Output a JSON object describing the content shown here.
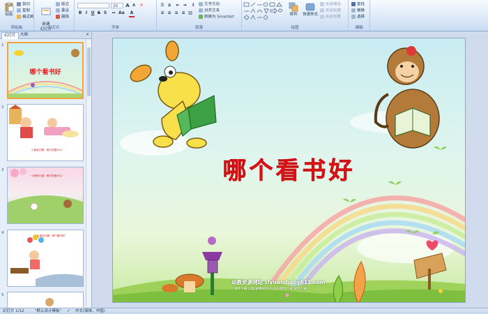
{
  "ribbon": {
    "clipboard": {
      "paste": "粘贴",
      "cut": "剪切",
      "copy": "复制",
      "format_painter": "格式刷",
      "label": "剪贴板"
    },
    "slides": {
      "new_slide": "新建\n幻灯片",
      "layout": "版式",
      "reset": "重设",
      "delete": "删除",
      "label": "幻灯片"
    },
    "font": {
      "font_name": "",
      "font_size": "20",
      "label": "字体"
    },
    "paragraph": {
      "text_direction": "文字方向",
      "align_text": "对齐文本",
      "smartart": "转换为 SmartArt",
      "label": "段落"
    },
    "drawing": {
      "arrange": "排列",
      "quick_styles": "快速样式",
      "shape_fill": "形状填充",
      "shape_outline": "形状轮廓",
      "shape_effects": "形状效果",
      "label": "绘图"
    },
    "editing": {
      "find": "查找",
      "replace": "替换",
      "select": "选择",
      "label": "编辑"
    }
  },
  "left_pane": {
    "tab_slides": "幻灯片",
    "tab_outline": "大纲",
    "thumbnails": [
      {
        "num": "1",
        "caption": "哪个看书好"
      },
      {
        "num": "2",
        "caption": "小朋友们看，他们在做什么？"
      },
      {
        "num": "3",
        "caption": "小狗和小猫，他们在做什么？"
      },
      {
        "num": "4",
        "caption": "小朋友们看，哪个看书好？"
      },
      {
        "num": "5",
        "caption": ""
      }
    ]
  },
  "slide": {
    "title": "哪个看书好",
    "site": "幼教资源网站  ziyuan.baby611.com",
    "links": "课件下载   儿歌   故事MP3   FLASH课件下载   试卷下载"
  },
  "status": {
    "slide_counter": "幻灯片 1/12",
    "theme": "\"默认设计模板\"",
    "language": "中文(简体，中国)"
  },
  "colors": {
    "title_red": "#f2171b",
    "selection_orange": "#f2a33a"
  }
}
